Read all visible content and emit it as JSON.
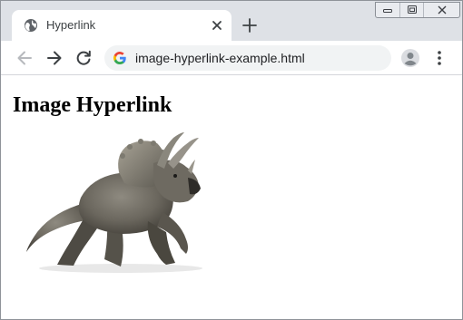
{
  "browser": {
    "tab": {
      "title": "Hyperlink",
      "icon": "globe-icon"
    },
    "address_bar": {
      "url": "image-hyperlink-example.html",
      "icon": "google-g-icon"
    },
    "toolbar_icons": [
      "back-arrow-icon",
      "forward-arrow-icon",
      "reload-icon",
      "profile-avatar-icon",
      "kebab-menu-icon"
    ],
    "window_controls": [
      "minimize-icon",
      "maximize-icon",
      "close-icon"
    ]
  },
  "page": {
    "heading": "Image Hyperlink",
    "image_link": {
      "icon": "triceratops-image"
    }
  },
  "colors": {
    "tabstrip": "#dee1e6",
    "omnibox": "#f1f3f4",
    "icon_gray": "#5f6368",
    "google_blue": "#4285f4",
    "google_red": "#ea4335",
    "google_yellow": "#fbbc05",
    "google_green": "#34a853"
  }
}
